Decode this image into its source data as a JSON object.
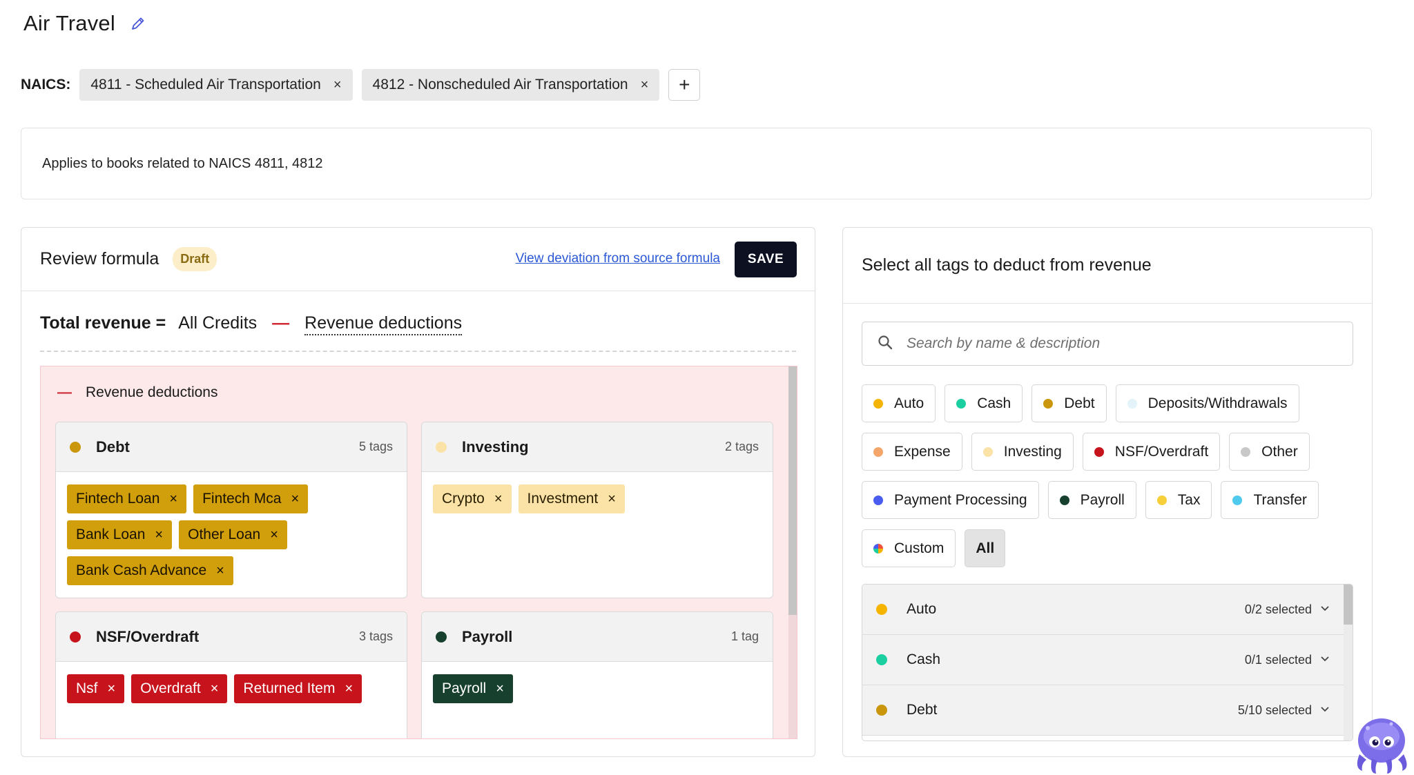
{
  "page": {
    "title": "Air Travel"
  },
  "naics": {
    "label": "NAICS:",
    "chips": [
      {
        "label": "4811 - Scheduled Air Transportation"
      },
      {
        "label": "4812 - Nonscheduled Air Transportation"
      }
    ],
    "remove_glyph": "×",
    "add_glyph": "+"
  },
  "description": "Applies to books related to NAICS 4811, 4812",
  "review": {
    "title": "Review formula",
    "badge": "Draft",
    "deviation_link": "View deviation from source formula",
    "save_label": "SAVE",
    "formula": {
      "lhs": "Total revenue =",
      "term1": "All Credits",
      "op": "—",
      "term2": "Revenue deductions"
    },
    "deductions": {
      "dash": "—",
      "title": "Revenue deductions",
      "categories": [
        {
          "name": "Debt",
          "count": "5 tags",
          "color": "#c9960c",
          "tags": [
            "Fintech Loan",
            "Fintech Mca",
            "Bank Loan",
            "Other Loan",
            "Bank Cash Advance"
          ]
        },
        {
          "name": "Investing",
          "count": "2 tags",
          "color": "#fbe3a8",
          "tags": [
            "Crypto",
            "Investment"
          ]
        },
        {
          "name": "NSF/Overdraft",
          "count": "3 tags",
          "color": "#c7131b",
          "tags": [
            "Nsf",
            "Overdraft",
            "Returned Item"
          ]
        },
        {
          "name": "Payroll",
          "count": "1 tag",
          "color": "#17402f",
          "tags": [
            "Payroll"
          ]
        }
      ]
    }
  },
  "selector": {
    "title": "Select all tags to deduct from revenue",
    "search_placeholder": "Search by name & description",
    "filters": [
      {
        "label": "Auto",
        "color": "#f5b400"
      },
      {
        "label": "Cash",
        "color": "#1ccfa0"
      },
      {
        "label": "Debt",
        "color": "#c9960c"
      },
      {
        "label": "Deposits/Withdrawals",
        "color": "#e3f3f9"
      },
      {
        "label": "Expense",
        "color": "#f4a66a"
      },
      {
        "label": "Investing",
        "color": "#fbe3a8"
      },
      {
        "label": "NSF/Overdraft",
        "color": "#c7131b"
      },
      {
        "label": "Other",
        "color": "#c8c8c8"
      },
      {
        "label": "Payment Processing",
        "color": "#4a5cf0"
      },
      {
        "label": "Payroll",
        "color": "#17402f"
      },
      {
        "label": "Tax",
        "color": "#f7cf3a"
      },
      {
        "label": "Transfer",
        "color": "#4fc9ee"
      },
      {
        "label": "Custom",
        "color": "multicolor"
      },
      {
        "label": "All",
        "color": ""
      }
    ],
    "list": [
      {
        "name": "Auto",
        "selected": "0/2 selected",
        "color": "#f5b400"
      },
      {
        "name": "Cash",
        "selected": "0/1 selected",
        "color": "#1ccfa0"
      },
      {
        "name": "Debt",
        "selected": "5/10 selected",
        "color": "#c9960c"
      }
    ]
  }
}
